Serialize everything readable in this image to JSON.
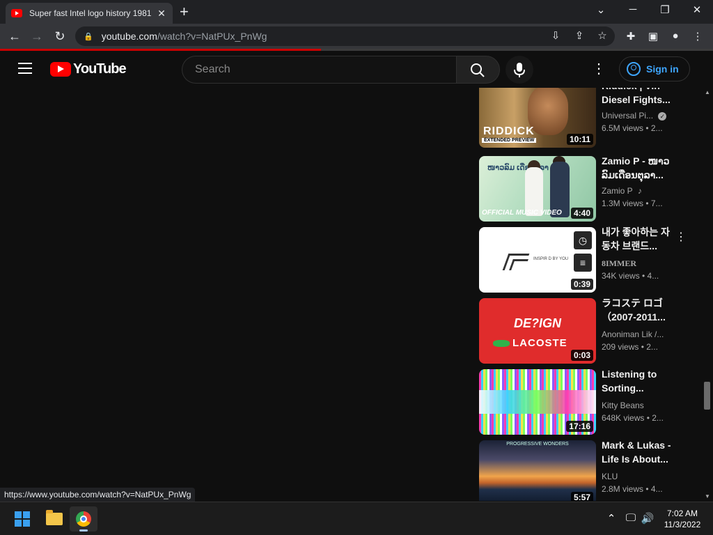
{
  "browser": {
    "tab_title": "Super fast Intel logo history 1981",
    "tab_close_icon": "✕",
    "new_tab_icon": "+",
    "url_host": "youtube.com",
    "url_path": "/watch?v=NatPUx_PnWg",
    "status_url": "https://www.youtube.com/watch?v=NatPUx_PnWg",
    "load_progress": 0.45
  },
  "youtube": {
    "logo_text": "YouTube",
    "search_placeholder": "Search",
    "sign_in_label": "Sign in"
  },
  "recommendations": [
    {
      "title": "Riddick | Vin Diesel Fights...",
      "channel": "Universal Pi...",
      "verified": true,
      "meta": "6.5M views • 2...",
      "duration": "10:11",
      "thumb_text": "RIDDICK",
      "thumb_subtext": "EXTENDED PREVIEW"
    },
    {
      "title": "Zamio P - ໜາວ ລົມເດືອນຕຸລາ...",
      "channel": "Zamio P",
      "music": true,
      "meta": "1.3M views • 7...",
      "duration": "4:40",
      "thumb_text": "OFFICIAL MUSIC VIDEO",
      "thumb_script": "ໜາວລົມ ເດືອນຕຸລາ"
    },
    {
      "title": "내가 좋아하는 자동차 브랜드...",
      "channel": "8IMMER",
      "meta": "34K views • 4...",
      "duration": "0:39",
      "thumb_text": "INSPIR D BY YOU"
    },
    {
      "title": "ラコステ ロゴ（2007-2011...",
      "channel": "Anoniman Lik /...",
      "meta": "209 views • 2...",
      "duration": "0:03",
      "thumb_text": "DE?IGN",
      "thumb_subtext": "LACOSTE"
    },
    {
      "title": "Listening to Sorting...",
      "channel": "Kitty Beans",
      "meta": "648K views • 2...",
      "duration": "17:16"
    },
    {
      "title": "Mark & Lukas - Life Is About...",
      "channel": "KLU",
      "meta": "2.8M views • 4...",
      "duration": "5:57",
      "thumb_text": "PROGRESSIVE WONDERS"
    }
  ],
  "taskbar": {
    "time": "7:02 AM",
    "date": "11/3/2022"
  }
}
